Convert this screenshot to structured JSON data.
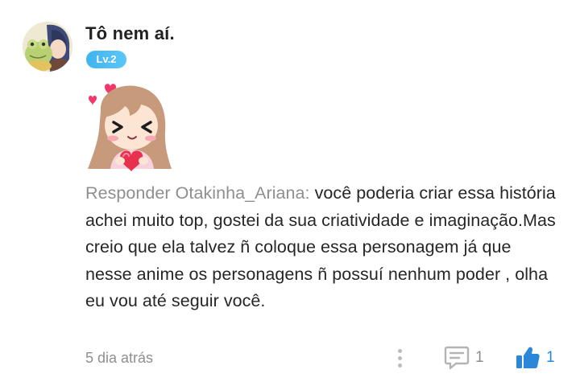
{
  "comment": {
    "author": "Tô nem aí.",
    "level_badge": "Lv.2",
    "avatar_icon": "anime-avatar-with-frog",
    "sticker_icon": "anime-girl-hearts-sticker",
    "reply_prefix": "Responder Otakinha_Ariana:",
    "text": " você poderia criar essa história achei muito top, gostei da sua criatividade e imaginação.Mas creio que ela talvez ñ coloque essa personagem já que nesse anime os personagens ñ possuí nenhum poder , olha eu vou até seguir você.",
    "timestamp": "5 dia atrás",
    "comments_count": "1",
    "likes_count": "1",
    "colors": {
      "badge": "#3fb4f0",
      "like_accent": "#2c86d9",
      "muted_text": "#8f8f8f"
    }
  }
}
